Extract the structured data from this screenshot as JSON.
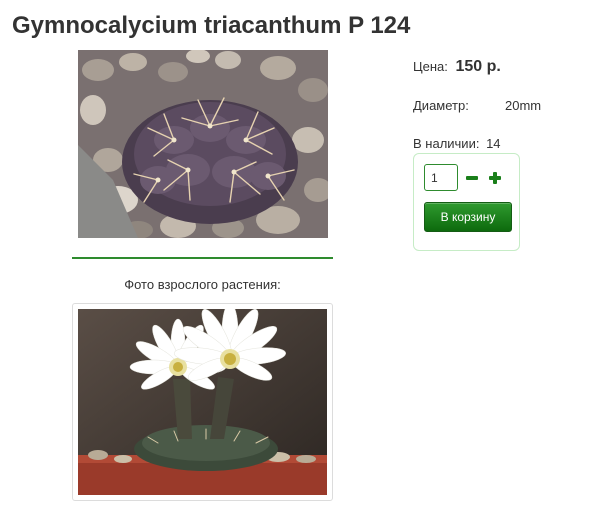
{
  "product": {
    "title": "Gymnocalycium triacanthum P 124",
    "price_label": "Цена:",
    "price_value": "150 р.",
    "diameter_label": "Диаметр:",
    "diameter_value": "20mm",
    "stock_label": "В наличии:",
    "stock_value": "14",
    "adult_photo_caption": "Фото взрослого растения:"
  },
  "cart": {
    "quantity": "1",
    "add_to_cart_label": "В корзину",
    "minus_icon": "minus-icon",
    "plus_icon": "plus-icon"
  },
  "colors": {
    "accent_green": "#2e8b2e",
    "button_green": "#1a7f1a",
    "box_border": "#c6ecc6"
  }
}
